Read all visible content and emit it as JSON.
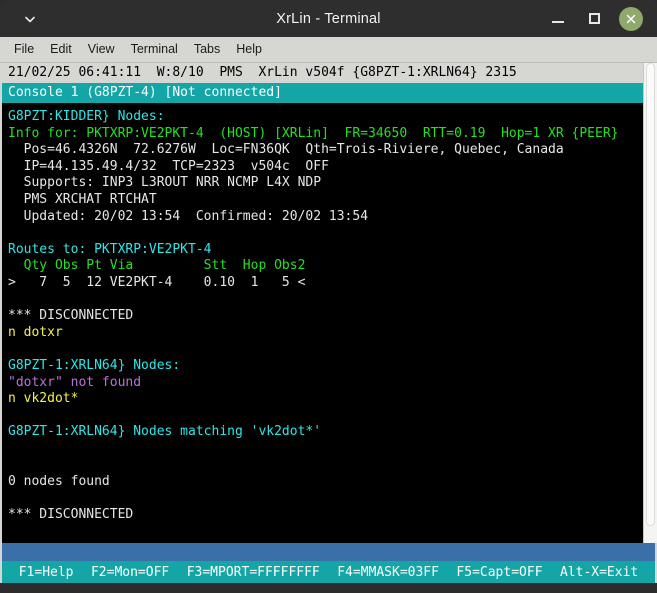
{
  "window": {
    "title": "XrLin - Terminal",
    "controls": {
      "menu_chevron": "chevron-down-icon",
      "minimize": "minimize-icon",
      "maximize": "maximize-icon",
      "close": "close-icon"
    }
  },
  "menubar": {
    "items": [
      {
        "label": "File"
      },
      {
        "label": "Edit"
      },
      {
        "label": "View"
      },
      {
        "label": "Terminal"
      },
      {
        "label": "Tabs"
      },
      {
        "label": "Help"
      }
    ]
  },
  "terminal": {
    "status_line": "21/02/25 06:41:11  W:8/10  PMS  XrLin v504f {G8PZT-1:XRLN64} 2315",
    "console_line": "Console 1 (G8PZT-4) [Not connected]",
    "lines": [
      {
        "text": "G8PZT:KIDDER} Nodes:",
        "color": "cyan"
      },
      {
        "text": "Info for: PKTXRP:VE2PKT-4  (HOST) [XRLin]  FR=34650  RTT=0.19  Hop=1 XR {PEER}",
        "color": "green"
      },
      {
        "text": "  Pos=46.4326N  72.6276W  Loc=FN36QK  Qth=Trois-Riviere, Quebec, Canada",
        "color": "white"
      },
      {
        "text": "  IP=44.135.49.4/32  TCP=2323  v504c  OFF",
        "color": "white"
      },
      {
        "text": "  Supports: INP3 L3ROUT NRR NCMP L4X NDP",
        "color": "white"
      },
      {
        "text": "  PMS XRCHAT RTCHAT",
        "color": "white"
      },
      {
        "text": "  Updated: 20/02 13:54  Confirmed: 20/02 13:54",
        "color": "white"
      },
      {
        "text": "",
        "color": "white"
      },
      {
        "text": "Routes to: PKTXRP:VE2PKT-4",
        "color": "cyan"
      },
      {
        "text": "  Qty Obs Pt Via         Stt  Hop Obs2",
        "color": "green"
      },
      {
        "text": ">   7  5  12 VE2PKT-4    0.10  1   5 <",
        "color": "white"
      },
      {
        "text": "",
        "color": "white"
      },
      {
        "text": "*** DISCONNECTED",
        "color": "white"
      },
      {
        "text": "n dotxr",
        "color": "yellow"
      },
      {
        "text": "",
        "color": "white"
      },
      {
        "text": "G8PZT-1:XRLN64} Nodes:",
        "color": "cyan"
      },
      {
        "text": "\"dotxr\" not found",
        "color": "purple"
      },
      {
        "text": "n vk2dot*",
        "color": "yellow"
      },
      {
        "text": "",
        "color": "white"
      },
      {
        "text": "G8PZT-1:XRLN64} Nodes matching 'vk2dot*'",
        "color": "cyan"
      },
      {
        "text": "",
        "color": "white"
      },
      {
        "text": "",
        "color": "white"
      },
      {
        "text": "0 nodes found",
        "color": "white"
      },
      {
        "text": "",
        "color": "white"
      },
      {
        "text": "*** DISCONNECTED",
        "color": "white"
      }
    ]
  },
  "command_input": {
    "value": "",
    "placeholder": ""
  },
  "function_keys": {
    "items": [
      {
        "label": "F1=Help"
      },
      {
        "label": "F2=Mon=OFF"
      },
      {
        "label": "F3=MPORT=FFFFFFFF"
      },
      {
        "label": "F4=MMASK=03FF"
      },
      {
        "label": "F5=Capt=OFF"
      },
      {
        "label": "Alt-X=Exit"
      }
    ]
  },
  "colors": {
    "accent_teal": "#14a6a6",
    "command_blue": "#3b6fa8",
    "close_green": "#8fa86b",
    "terminal_bg": "#000000",
    "chrome_gray": "#d6d6d2"
  }
}
